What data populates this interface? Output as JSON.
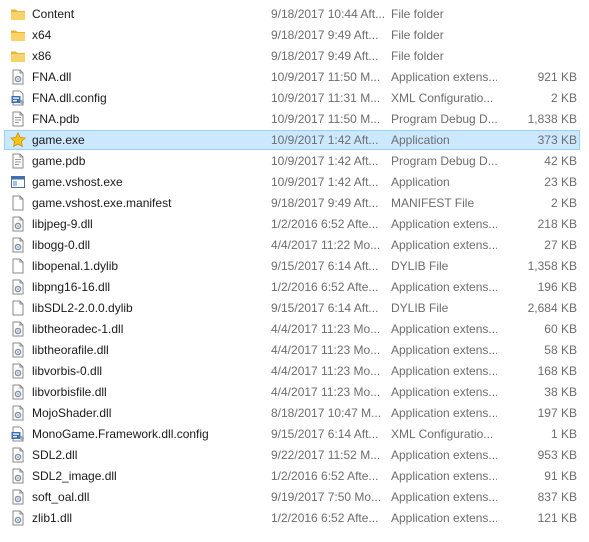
{
  "files": [
    {
      "name": "Content",
      "date": "9/18/2017 10:44 Aft...",
      "type": "File folder",
      "size": "",
      "icon": "folder-icon"
    },
    {
      "name": "x64",
      "date": "9/18/2017 9:49 Aft...",
      "type": "File folder",
      "size": "",
      "icon": "folder-icon"
    },
    {
      "name": "x86",
      "date": "9/18/2017 9:49 Aft...",
      "type": "File folder",
      "size": "",
      "icon": "folder-icon"
    },
    {
      "name": "FNA.dll",
      "date": "10/9/2017 11:50 M...",
      "type": "Application extens...",
      "size": "921 KB",
      "icon": "dll-icon"
    },
    {
      "name": "FNA.dll.config",
      "date": "10/9/2017 11:31 M...",
      "type": "XML Configuratio...",
      "size": "2 KB",
      "icon": "config-icon"
    },
    {
      "name": "FNA.pdb",
      "date": "10/9/2017 11:50 M...",
      "type": "Program Debug D...",
      "size": "1,838 KB",
      "icon": "pdb-icon"
    },
    {
      "name": "game.exe",
      "date": "10/9/2017 1:42 Aft...",
      "type": "Application",
      "size": "373 KB",
      "icon": "star-icon",
      "selected": true
    },
    {
      "name": "game.pdb",
      "date": "10/9/2017 1:42 Aft...",
      "type": "Program Debug D...",
      "size": "42 KB",
      "icon": "pdb-icon"
    },
    {
      "name": "game.vshost.exe",
      "date": "10/9/2017 1:42 Aft...",
      "type": "Application",
      "size": "23 KB",
      "icon": "exe-window-icon"
    },
    {
      "name": "game.vshost.exe.manifest",
      "date": "9/18/2017 9:49 Aft...",
      "type": "MANIFEST File",
      "size": "2 KB",
      "icon": "file-icon"
    },
    {
      "name": "libjpeg-9.dll",
      "date": "1/2/2016 6:52 Afte...",
      "type": "Application extens...",
      "size": "218 KB",
      "icon": "dll-icon"
    },
    {
      "name": "libogg-0.dll",
      "date": "4/4/2017 11:22 Mo...",
      "type": "Application extens...",
      "size": "27 KB",
      "icon": "dll-icon"
    },
    {
      "name": "libopenal.1.dylib",
      "date": "9/15/2017 6:14 Aft...",
      "type": "DYLIB File",
      "size": "1,358 KB",
      "icon": "file-icon"
    },
    {
      "name": "libpng16-16.dll",
      "date": "1/2/2016 6:52 Afte...",
      "type": "Application extens...",
      "size": "196 KB",
      "icon": "dll-icon"
    },
    {
      "name": "libSDL2-2.0.0.dylib",
      "date": "9/15/2017 6:14 Aft...",
      "type": "DYLIB File",
      "size": "2,684 KB",
      "icon": "file-icon"
    },
    {
      "name": "libtheoradec-1.dll",
      "date": "4/4/2017 11:23 Mo...",
      "type": "Application extens...",
      "size": "60 KB",
      "icon": "dll-icon"
    },
    {
      "name": "libtheorafile.dll",
      "date": "4/4/2017 11:23 Mo...",
      "type": "Application extens...",
      "size": "58 KB",
      "icon": "dll-icon"
    },
    {
      "name": "libvorbis-0.dll",
      "date": "4/4/2017 11:23 Mo...",
      "type": "Application extens...",
      "size": "168 KB",
      "icon": "dll-icon"
    },
    {
      "name": "libvorbisfile.dll",
      "date": "4/4/2017 11:23 Mo...",
      "type": "Application extens...",
      "size": "38 KB",
      "icon": "dll-icon"
    },
    {
      "name": "MojoShader.dll",
      "date": "8/18/2017 10:47 M...",
      "type": "Application extens...",
      "size": "197 KB",
      "icon": "dll-icon"
    },
    {
      "name": "MonoGame.Framework.dll.config",
      "date": "9/15/2017 6:14 Aft...",
      "type": "XML Configuratio...",
      "size": "1 KB",
      "icon": "config-icon"
    },
    {
      "name": "SDL2.dll",
      "date": "9/22/2017 11:52 M...",
      "type": "Application extens...",
      "size": "953 KB",
      "icon": "dll-icon"
    },
    {
      "name": "SDL2_image.dll",
      "date": "1/2/2016 6:52 Afte...",
      "type": "Application extens...",
      "size": "91 KB",
      "icon": "dll-icon"
    },
    {
      "name": "soft_oal.dll",
      "date": "9/19/2017 7:50 Mo...",
      "type": "Application extens...",
      "size": "837 KB",
      "icon": "dll-icon"
    },
    {
      "name": "zlib1.dll",
      "date": "1/2/2016 6:52 Afte...",
      "type": "Application extens...",
      "size": "121 KB",
      "icon": "dll-icon"
    }
  ],
  "colors": {
    "selection_bg": "#cce8ff",
    "selection_border": "#99d1ff",
    "secondary_text": "#6d6d6d",
    "folder": "#f4c542"
  }
}
